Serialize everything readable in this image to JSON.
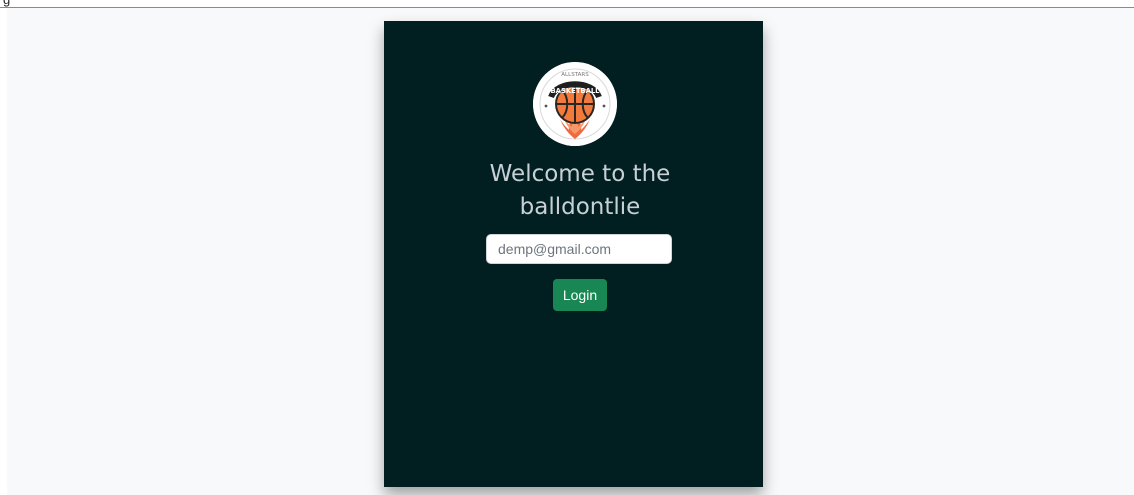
{
  "top_strip": {
    "label": "g"
  },
  "login": {
    "logo": {
      "icon": "basketball-logo-icon",
      "ring_text": "ALLSTARS",
      "banner_text": "BASKETBALL"
    },
    "title": "Welcome to the\nballdontlie",
    "email": {
      "value": "",
      "placeholder": "demp@gmail.com"
    },
    "button_label": "Login"
  },
  "colors": {
    "page_background": "#f8f9fa",
    "card_background": "#011e20",
    "title_text": "#c7d0d4",
    "button_background": "#198754",
    "button_text": "#ffffff"
  }
}
